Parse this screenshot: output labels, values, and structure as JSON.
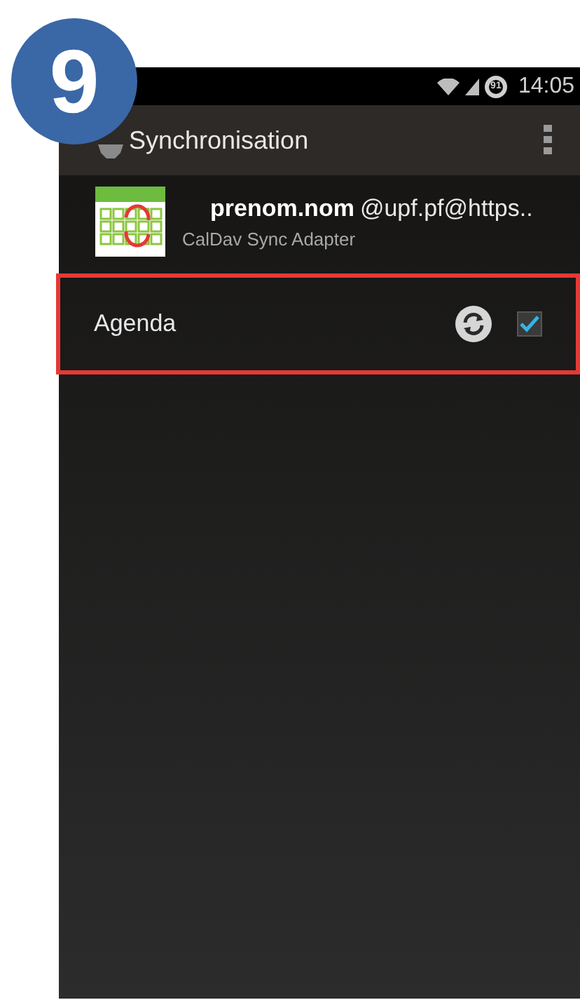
{
  "step_badge": "9",
  "status_bar": {
    "battery": "91",
    "time": "14:05"
  },
  "action_bar": {
    "title": "Synchronisation"
  },
  "account": {
    "name": "prenom.nom",
    "address": "@upf.pf@https..",
    "type": "CalDav Sync Adapter"
  },
  "sync_items": [
    {
      "label": "Agenda",
      "highlighted": true,
      "checked": true
    }
  ]
}
